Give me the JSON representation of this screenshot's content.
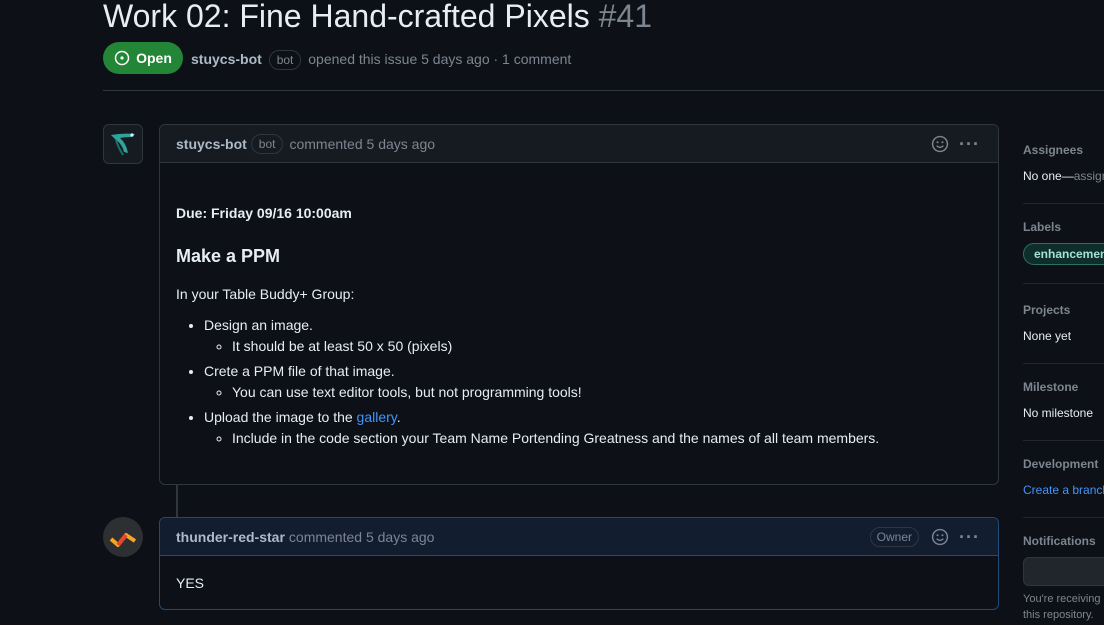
{
  "issue": {
    "title": "Work 02: Fine Hand-crafted Pixels",
    "number": "#41",
    "status": "Open",
    "author": "stuycs-bot",
    "author_badge": "bot",
    "meta_text": "opened this issue 5 days ago · 1 comment"
  },
  "comments": [
    {
      "author": "stuycs-bot",
      "badge": "bot",
      "time": "commented 5 days ago",
      "due": "Due: Friday 09/16 10:00am",
      "heading": "Make a PPM",
      "intro": "In your Table Buddy+ Group:",
      "items": [
        {
          "text": "Design an image.",
          "sub": "It should be at least 50 x 50 (pixels)"
        },
        {
          "text": "Crete a PPM file of that image.",
          "sub": "You can use text editor tools, but not programming tools!"
        },
        {
          "text_before": "Upload the image to the ",
          "link": "gallery",
          "text_after": ".",
          "sub": "Include in the code section your Team Name Portending Greatness and the names of all team members."
        }
      ]
    },
    {
      "author": "thunder-red-star",
      "time": "commented 5 days ago",
      "role": "Owner",
      "body": "YES"
    }
  ],
  "sidebar": {
    "assignees_label": "Assignees",
    "assignees_value": "No one—",
    "assignees_action": "assign yourself",
    "labels_label": "Labels",
    "label_pill": "enhancement",
    "projects_label": "Projects",
    "projects_value": "None yet",
    "milestone_label": "Milestone",
    "milestone_value": "No milestone",
    "development_label": "Development",
    "development_value": "Create a branch",
    "notifications_label": "Notifications",
    "notifications_text_1": "You're receiving",
    "notifications_text_2": "this repository."
  },
  "colors": {
    "open_green": "#238636",
    "link_blue": "#4493f8",
    "background": "#0d1117"
  }
}
